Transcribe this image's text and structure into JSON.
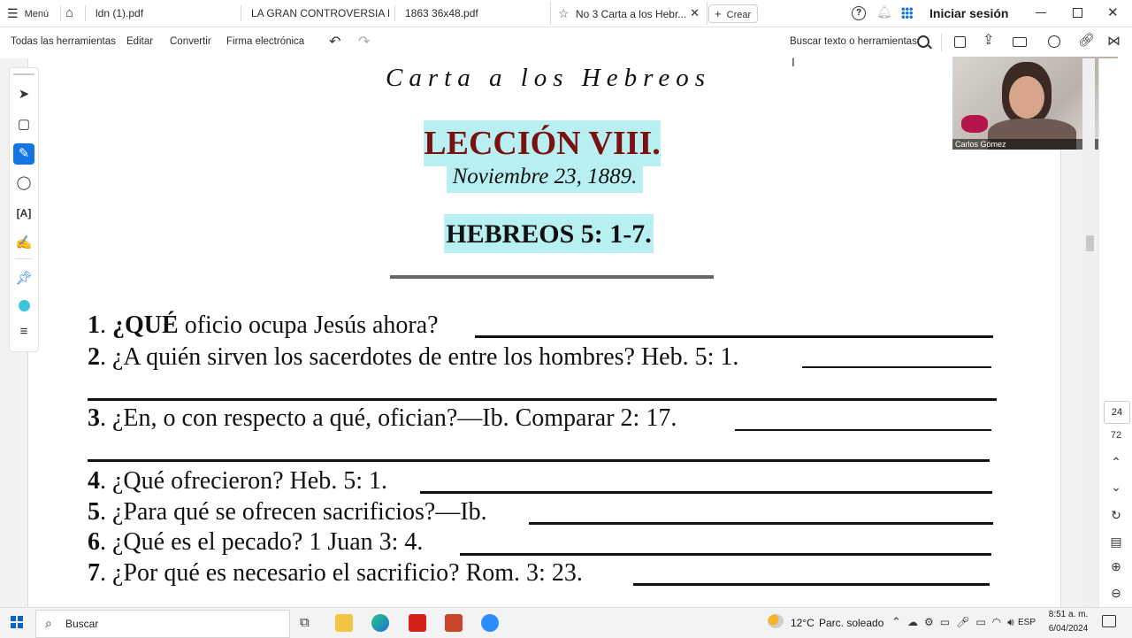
{
  "titlebar": {
    "menu_label": "Menú",
    "tabs": [
      {
        "label": "ldn (1).pdf"
      },
      {
        "label": "LA GRAN CONTROVERSIA E..."
      },
      {
        "label": "1863 36x48.pdf"
      },
      {
        "label": "No 3 Carta a los Hebr..."
      }
    ],
    "create_label": "Crear",
    "signin_label": "Iniciar sesión"
  },
  "toolbar": {
    "items": [
      "Todas las herramientas",
      "Editar",
      "Convertir",
      "Firma electrónica"
    ],
    "search_label": "Buscar texto o herramientas"
  },
  "document": {
    "header": "Carta a los Hebreos",
    "lesson": "LECCIÓN VIII.",
    "date": "Noviembre 23, 1889.",
    "passage": "HEBREOS 5: 1-7.",
    "questions": [
      {
        "num": "1",
        "text_bold": "¿QUÉ",
        "text": " oficio ocupa Jesús ahora?"
      },
      {
        "num": "2",
        "text": " ¿A quién sirven los sacerdotes de entre los hombres? Heb. 5: 1."
      },
      {
        "num": "3",
        "text": " ¿En, o con respecto a qué, ofician?—Ib. Comparar 2: 17."
      },
      {
        "num": "4",
        "text": " ¿Qué ofrecieron? Heb. 5: 1."
      },
      {
        "num": "5",
        "text": " ¿Para qué se ofrecen sacrificios?—Ib."
      },
      {
        "num": "6",
        "text": " ¿Qué es el pecado? 1 Juan 3: 4."
      },
      {
        "num": "7",
        "text": " ¿Por qué es necesario el sacrificio? Rom. 3: 23."
      }
    ]
  },
  "video": {
    "participant": "Carlos Gómez"
  },
  "rightpanel": {
    "page_current": "24",
    "page_total": "72"
  },
  "taskbar": {
    "search_label": "Buscar",
    "weather_temp": "12°C",
    "weather_text": "Parc. soleado",
    "lang": "ESP",
    "time": "8:51 a. m.",
    "date": "6/04/2024"
  },
  "colors": {
    "highlight": "#b8f0f2",
    "lesson_red": "#7a1010",
    "accent_blue": "#1473e6"
  }
}
